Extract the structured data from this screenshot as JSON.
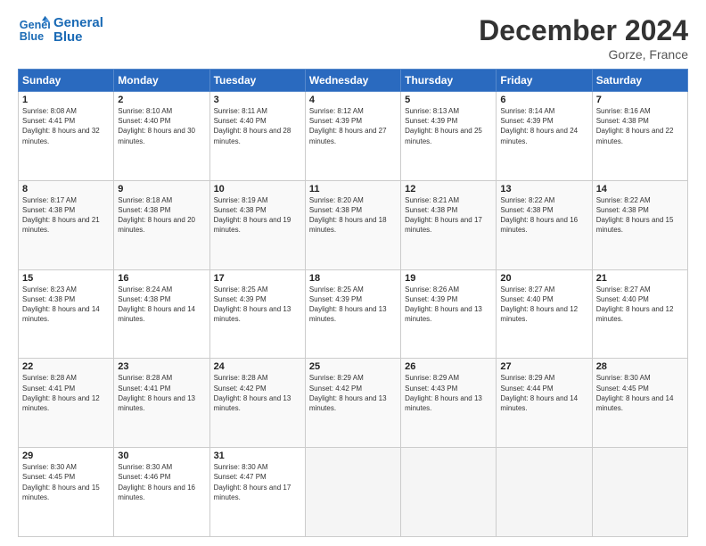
{
  "header": {
    "logo_line1": "General",
    "logo_line2": "Blue",
    "month_title": "December 2024",
    "location": "Gorze, France"
  },
  "days_of_week": [
    "Sunday",
    "Monday",
    "Tuesday",
    "Wednesday",
    "Thursday",
    "Friday",
    "Saturday"
  ],
  "weeks": [
    [
      {
        "day": "1",
        "sunrise": "8:08 AM",
        "sunset": "4:41 PM",
        "daylight": "8 hours and 32 minutes."
      },
      {
        "day": "2",
        "sunrise": "8:10 AM",
        "sunset": "4:40 PM",
        "daylight": "8 hours and 30 minutes."
      },
      {
        "day": "3",
        "sunrise": "8:11 AM",
        "sunset": "4:40 PM",
        "daylight": "8 hours and 28 minutes."
      },
      {
        "day": "4",
        "sunrise": "8:12 AM",
        "sunset": "4:39 PM",
        "daylight": "8 hours and 27 minutes."
      },
      {
        "day": "5",
        "sunrise": "8:13 AM",
        "sunset": "4:39 PM",
        "daylight": "8 hours and 25 minutes."
      },
      {
        "day": "6",
        "sunrise": "8:14 AM",
        "sunset": "4:39 PM",
        "daylight": "8 hours and 24 minutes."
      },
      {
        "day": "7",
        "sunrise": "8:16 AM",
        "sunset": "4:38 PM",
        "daylight": "8 hours and 22 minutes."
      }
    ],
    [
      {
        "day": "8",
        "sunrise": "8:17 AM",
        "sunset": "4:38 PM",
        "daylight": "8 hours and 21 minutes."
      },
      {
        "day": "9",
        "sunrise": "8:18 AM",
        "sunset": "4:38 PM",
        "daylight": "8 hours and 20 minutes."
      },
      {
        "day": "10",
        "sunrise": "8:19 AM",
        "sunset": "4:38 PM",
        "daylight": "8 hours and 19 minutes."
      },
      {
        "day": "11",
        "sunrise": "8:20 AM",
        "sunset": "4:38 PM",
        "daylight": "8 hours and 18 minutes."
      },
      {
        "day": "12",
        "sunrise": "8:21 AM",
        "sunset": "4:38 PM",
        "daylight": "8 hours and 17 minutes."
      },
      {
        "day": "13",
        "sunrise": "8:22 AM",
        "sunset": "4:38 PM",
        "daylight": "8 hours and 16 minutes."
      },
      {
        "day": "14",
        "sunrise": "8:22 AM",
        "sunset": "4:38 PM",
        "daylight": "8 hours and 15 minutes."
      }
    ],
    [
      {
        "day": "15",
        "sunrise": "8:23 AM",
        "sunset": "4:38 PM",
        "daylight": "8 hours and 14 minutes."
      },
      {
        "day": "16",
        "sunrise": "8:24 AM",
        "sunset": "4:38 PM",
        "daylight": "8 hours and 14 minutes."
      },
      {
        "day": "17",
        "sunrise": "8:25 AM",
        "sunset": "4:39 PM",
        "daylight": "8 hours and 13 minutes."
      },
      {
        "day": "18",
        "sunrise": "8:25 AM",
        "sunset": "4:39 PM",
        "daylight": "8 hours and 13 minutes."
      },
      {
        "day": "19",
        "sunrise": "8:26 AM",
        "sunset": "4:39 PM",
        "daylight": "8 hours and 13 minutes."
      },
      {
        "day": "20",
        "sunrise": "8:27 AM",
        "sunset": "4:40 PM",
        "daylight": "8 hours and 12 minutes."
      },
      {
        "day": "21",
        "sunrise": "8:27 AM",
        "sunset": "4:40 PM",
        "daylight": "8 hours and 12 minutes."
      }
    ],
    [
      {
        "day": "22",
        "sunrise": "8:28 AM",
        "sunset": "4:41 PM",
        "daylight": "8 hours and 12 minutes."
      },
      {
        "day": "23",
        "sunrise": "8:28 AM",
        "sunset": "4:41 PM",
        "daylight": "8 hours and 13 minutes."
      },
      {
        "day": "24",
        "sunrise": "8:28 AM",
        "sunset": "4:42 PM",
        "daylight": "8 hours and 13 minutes."
      },
      {
        "day": "25",
        "sunrise": "8:29 AM",
        "sunset": "4:42 PM",
        "daylight": "8 hours and 13 minutes."
      },
      {
        "day": "26",
        "sunrise": "8:29 AM",
        "sunset": "4:43 PM",
        "daylight": "8 hours and 13 minutes."
      },
      {
        "day": "27",
        "sunrise": "8:29 AM",
        "sunset": "4:44 PM",
        "daylight": "8 hours and 14 minutes."
      },
      {
        "day": "28",
        "sunrise": "8:30 AM",
        "sunset": "4:45 PM",
        "daylight": "8 hours and 14 minutes."
      }
    ],
    [
      {
        "day": "29",
        "sunrise": "8:30 AM",
        "sunset": "4:45 PM",
        "daylight": "8 hours and 15 minutes."
      },
      {
        "day": "30",
        "sunrise": "8:30 AM",
        "sunset": "4:46 PM",
        "daylight": "8 hours and 16 minutes."
      },
      {
        "day": "31",
        "sunrise": "8:30 AM",
        "sunset": "4:47 PM",
        "daylight": "8 hours and 17 minutes."
      },
      null,
      null,
      null,
      null
    ]
  ],
  "labels": {
    "sunrise_label": "Sunrise:",
    "sunset_label": "Sunset:",
    "daylight_label": "Daylight:"
  }
}
